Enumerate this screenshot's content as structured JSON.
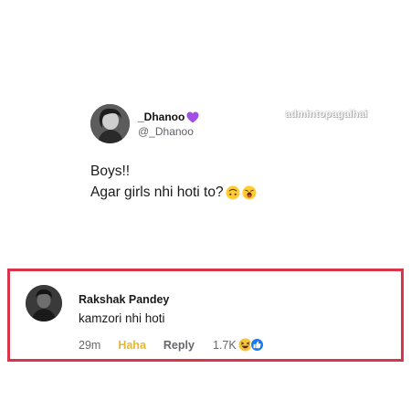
{
  "tweet": {
    "name": "_Dhanoo",
    "handle": "@_Dhanoo",
    "watermark": "admintopagalhai",
    "line1": "Boys!!",
    "line2": "Agar girls nhi hoti to?",
    "name_icon": "purple-heart-icon",
    "emojis": [
      "upside-down-face-emoji",
      "yawning-face-emoji"
    ]
  },
  "comment": {
    "author": "Rakshak Pandey",
    "text": "kamzori nhi hoti",
    "time": "29m",
    "reaction_label": "Haha",
    "reply_label": "Reply",
    "reaction_count": "1.7K",
    "reaction_icons": [
      "haha-icon",
      "like-icon"
    ]
  },
  "colors": {
    "highlight_border": "#d9344a",
    "haha": "#e8b730",
    "like_blue": "#1877f2",
    "secondary_text": "#65676b",
    "purple_heart": "#a24ee8"
  }
}
